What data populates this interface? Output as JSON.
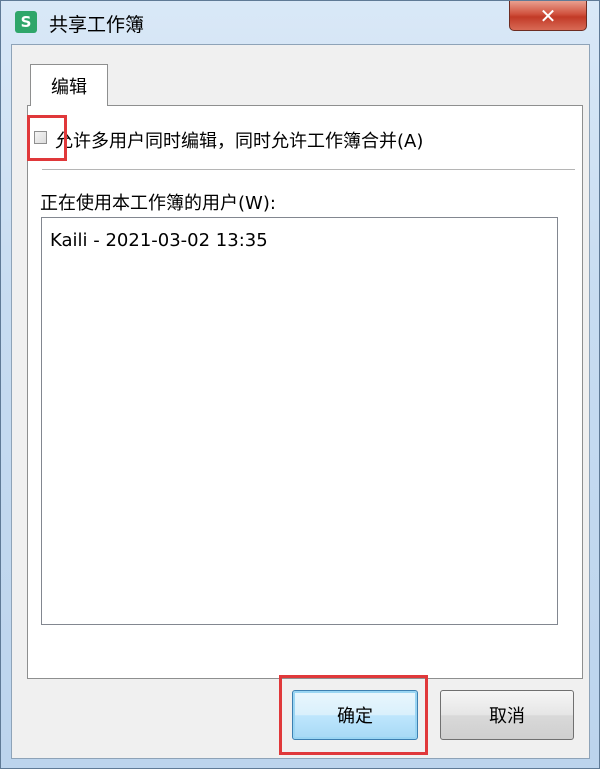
{
  "window": {
    "title": "共享工作簿",
    "app_icon_glyph": "S",
    "close_glyph": "✕"
  },
  "tabs": [
    {
      "label": "编辑"
    }
  ],
  "edit": {
    "allow_multi_user_label": "允许多用户同时编辑，同时允许工作簿合并(A)",
    "allow_multi_user_checked": false,
    "users_label": "正在使用本工作簿的用户(W):",
    "users": [
      "Kaili - 2021-03-02 13:35"
    ]
  },
  "buttons": {
    "ok_label": "确定",
    "cancel_label": "取消"
  },
  "colors": {
    "highlight": "#e0383a",
    "app_icon": "#2fa66a",
    "close_button": "#c23a27"
  }
}
